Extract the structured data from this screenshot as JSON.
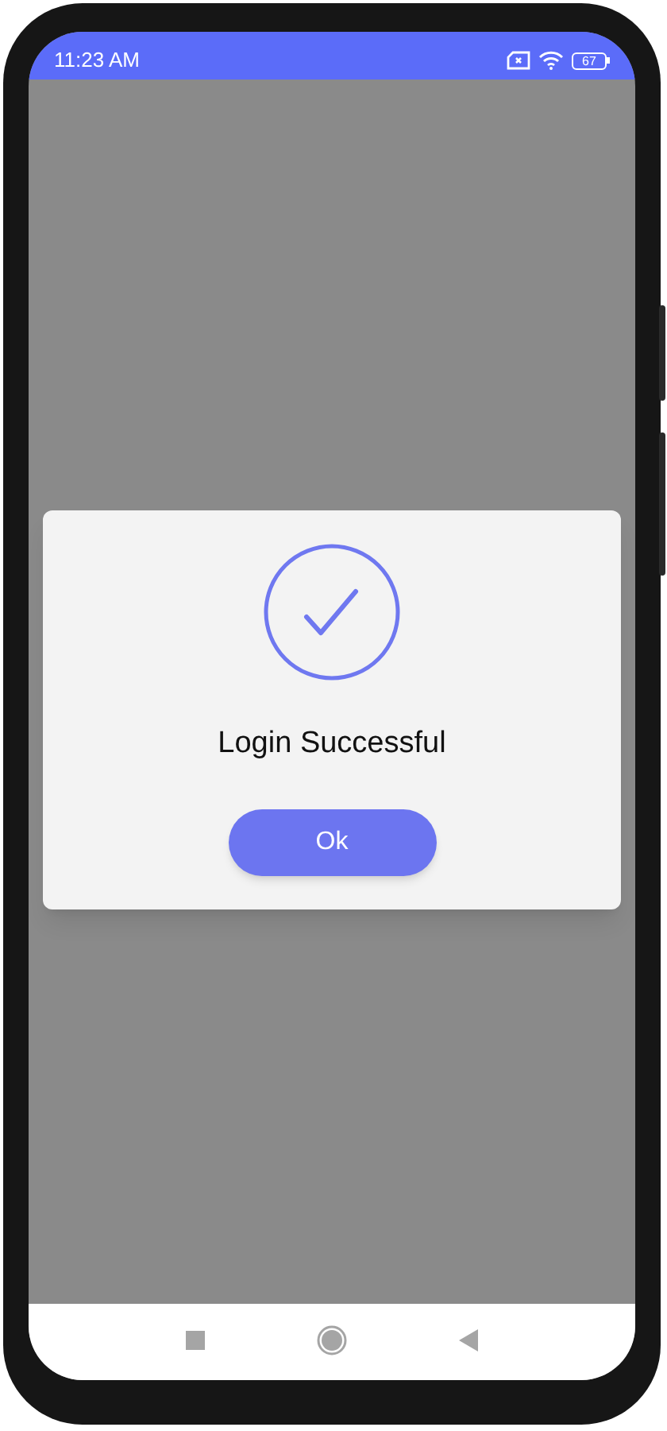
{
  "status_bar": {
    "time": "11:23 AM",
    "battery": "67"
  },
  "dialog": {
    "message": "Login Successful",
    "button": "Ok"
  }
}
